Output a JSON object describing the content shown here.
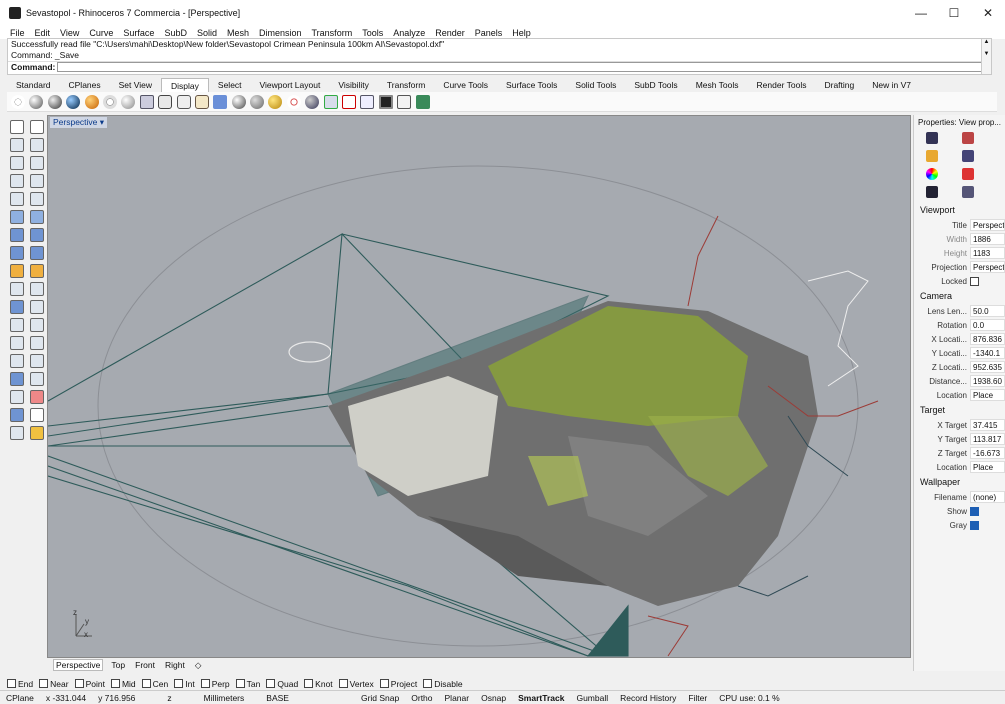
{
  "window": {
    "title": "Sevastopol - Rhinoceros 7 Commercia - [Perspective]",
    "minimize": "—",
    "maximize": "☐",
    "close": "✕"
  },
  "menu": [
    "File",
    "Edit",
    "View",
    "Curve",
    "Surface",
    "SubD",
    "Solid",
    "Mesh",
    "Dimension",
    "Transform",
    "Tools",
    "Analyze",
    "Render",
    "Panels",
    "Help"
  ],
  "command": {
    "history1": "Successfully read file \"C:\\Users\\mahi\\Desktop\\New folder\\Sevastopol Crimean Peninsula 100km AI\\Sevastopol.dxf\"",
    "history2": "Command: _Save",
    "prompt_label": "Command:",
    "value": ""
  },
  "tabs": [
    "Standard",
    "CPlanes",
    "Set View",
    "Display",
    "Select",
    "Viewport Layout",
    "Visibility",
    "Transform",
    "Curve Tools",
    "Surface Tools",
    "Solid Tools",
    "SubD Tools",
    "Mesh Tools",
    "Render Tools",
    "Drafting",
    "New in V7"
  ],
  "active_tab": "Display",
  "viewport": {
    "label": "Perspective ▾",
    "axis_x": "x",
    "axis_y": "y",
    "axis_z": "z"
  },
  "viewport_tabs": [
    "Perspective",
    "Top",
    "Front",
    "Right",
    "◇"
  ],
  "properties": {
    "header": "Properties: View prop...",
    "viewport_section": "Viewport",
    "title_label": "Title",
    "title_value": "Perspective",
    "width_label": "Width",
    "width_value": "1886",
    "height_label": "Height",
    "height_value": "1183",
    "projection_label": "Projection",
    "projection_value": "Perspective",
    "locked_label": "Locked",
    "camera_section": "Camera",
    "lens_label": "Lens Len...",
    "lens_value": "50.0",
    "rotation_label": "Rotation",
    "rotation_value": "0.0",
    "xloc_label": "X Locati...",
    "xloc_value": "876.836",
    "yloc_label": "Y Locati...",
    "yloc_value": "-1340.1",
    "zloc_label": "Z Locati...",
    "zloc_value": "952.635",
    "distance_label": "Distance...",
    "distance_value": "1938.60",
    "location_label": "Location",
    "location_value": "Place",
    "target_section": "Target",
    "xtarget_label": "X Target",
    "xtarget_value": "37.415",
    "ytarget_label": "Y Target",
    "ytarget_value": "113.817",
    "ztarget_label": "Z Target",
    "ztarget_value": "-16.673",
    "tlocation_label": "Location",
    "tlocation_value": "Place",
    "wallpaper_section": "Wallpaper",
    "filename_label": "Filename",
    "filename_value": "(none)",
    "show_label": "Show",
    "gray_label": "Gray"
  },
  "osnaps": [
    "End",
    "Near",
    "Point",
    "Mid",
    "Cen",
    "Int",
    "Perp",
    "Tan",
    "Quad",
    "Knot",
    "Vertex",
    "Project",
    "Disable"
  ],
  "status": {
    "cplane": "CPlane",
    "x": "x -331.044",
    "y": "y 716.956",
    "z": "z",
    "units": "Millimeters",
    "layer": "BASE",
    "gridsnap": "Grid Snap",
    "ortho": "Ortho",
    "planar": "Planar",
    "osnap": "Osnap",
    "smarttrack": "SmartTrack",
    "gumball": "Gumball",
    "record": "Record History",
    "filter": "Filter",
    "cpu": "CPU use: 0.1 %"
  },
  "colors": {
    "viewport_bg": "#a6aab0",
    "mesh_teal": "#2e5b5a",
    "terrain_green": "#8aa13a",
    "terrain_gray": "#6f6f6f"
  }
}
